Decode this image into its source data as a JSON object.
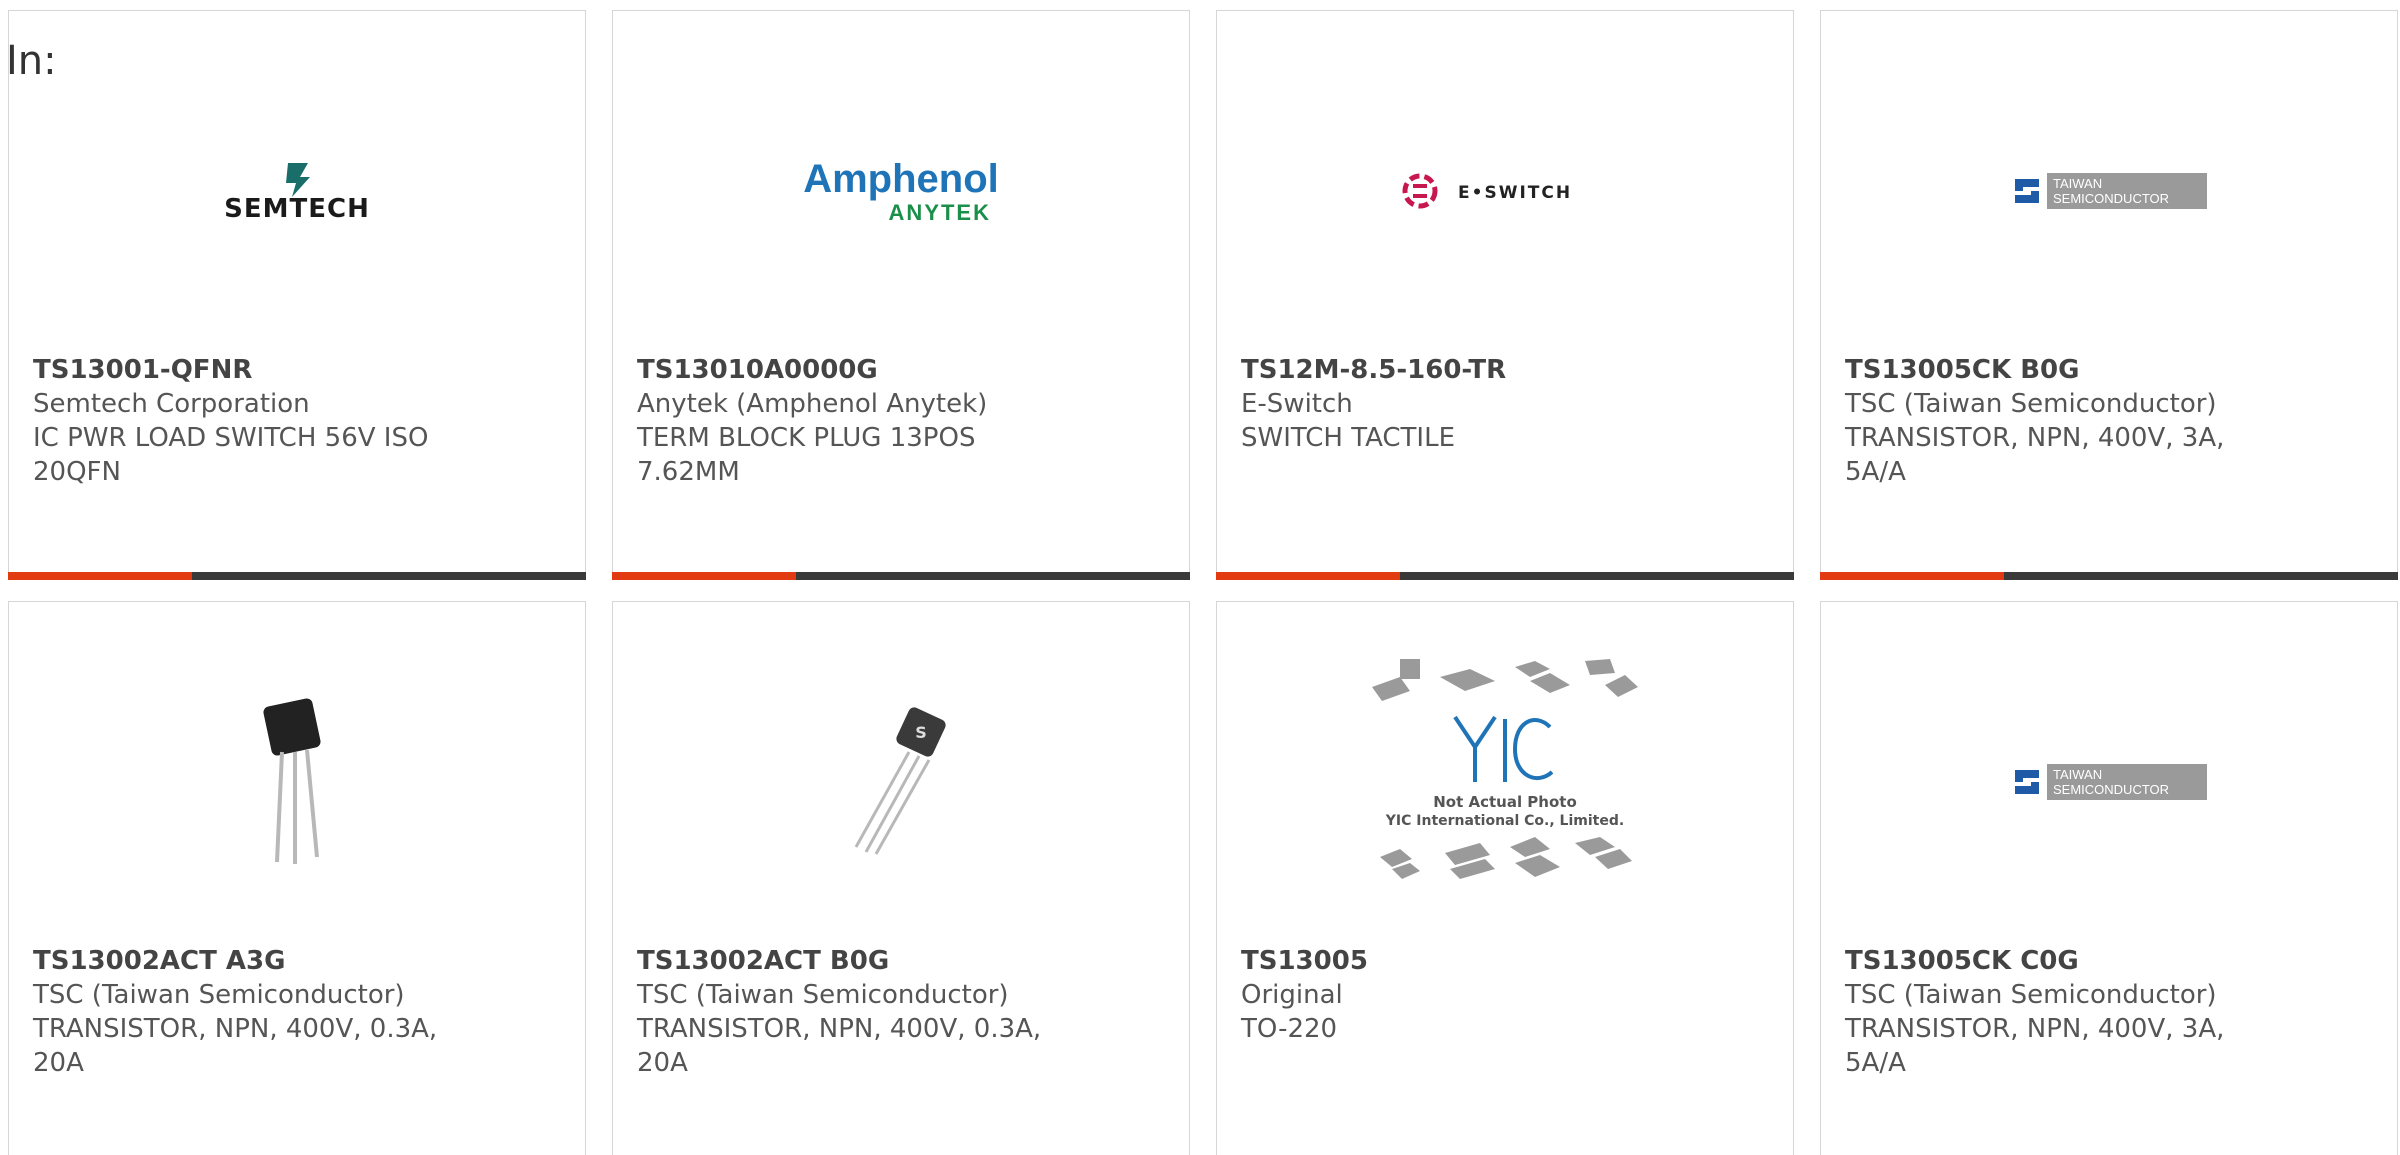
{
  "header": {
    "label": "In:"
  },
  "colors": {
    "accent": "#e23b12",
    "bar": "#3a3a3a",
    "text": "#555555"
  },
  "products": [
    {
      "part": "TS13001-QFNR",
      "maker": "Semtech Corporation",
      "desc": "IC PWR LOAD SWITCH 56V ISO 20QFN",
      "logo_icon": "semtech-logo",
      "logo_text": "SEMTECH"
    },
    {
      "part": "TS13010A0000G",
      "maker": "Anytek (Amphenol Anytek)",
      "desc": "TERM BLOCK PLUG 13POS 7.62MM",
      "logo_icon": "amphenol-anytek-logo",
      "logo_text_1": "Amphenol",
      "logo_text_2": "ANYTEK"
    },
    {
      "part": "TS12M-8.5-160-TR",
      "maker": "E-Switch",
      "desc": "SWITCH TACTILE",
      "logo_icon": "e-switch-logo",
      "logo_text": "E•SWITCH"
    },
    {
      "part": "TS13005CK B0G",
      "maker": "TSC (Taiwan Semiconductor)",
      "desc": "TRANSISTOR, NPN, 400V, 3A, 5A/A",
      "logo_icon": "taiwan-semiconductor-logo",
      "logo_text_1": "TAIWAN",
      "logo_text_2": "SEMICONDUCTOR"
    },
    {
      "part": "TS13002ACT A3G",
      "maker": "TSC (Taiwan Semiconductor)",
      "desc": "TRANSISTOR, NPN, 400V, 0.3A, 20A",
      "logo_icon": "to92-transistor-photo"
    },
    {
      "part": "TS13002ACT B0G",
      "maker": "TSC (Taiwan Semiconductor)",
      "desc": "TRANSISTOR, NPN, 400V, 0.3A, 20A",
      "logo_icon": "to92-transistor-photo-tsc"
    },
    {
      "part": "TS13005",
      "maker": "Original",
      "desc": "TO-220",
      "logo_icon": "yic-placeholder-image",
      "logo_text_1": "Not Actual Photo",
      "logo_text_2": "YIC International Co., Limited."
    },
    {
      "part": "TS13005CK C0G",
      "maker": "TSC (Taiwan Semiconductor)",
      "desc": "TRANSISTOR, NPN, 400V, 3A, 5A/A",
      "logo_icon": "taiwan-semiconductor-logo",
      "logo_text_1": "TAIWAN",
      "logo_text_2": "SEMICONDUCTOR"
    }
  ]
}
